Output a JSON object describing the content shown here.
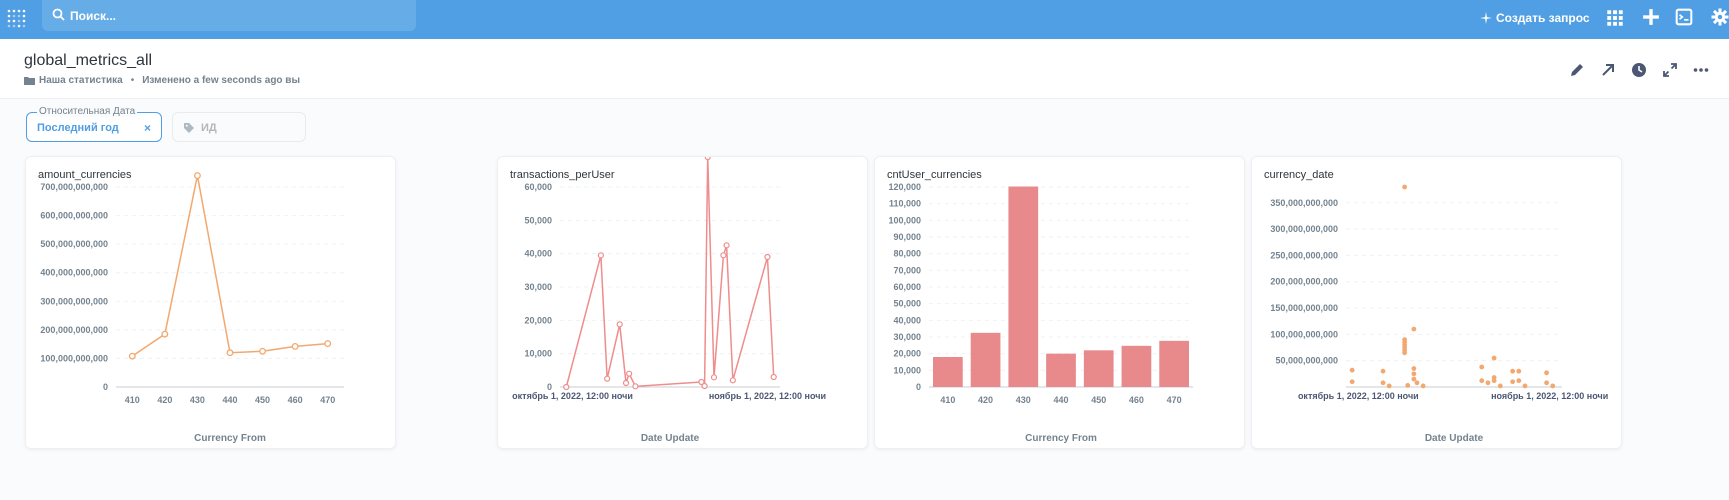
{
  "nav": {
    "search_placeholder": "Поиск...",
    "new_question": "Создать запрос",
    "colors": {
      "bar": "#509ee3",
      "search": "#66ace7"
    }
  },
  "header": {
    "title": "global_metrics_all",
    "collection": "Наша статистика",
    "edited": "Изменено a few seconds ago вы"
  },
  "filters": {
    "date_label": "Относительная Дата",
    "date_value": "Последний год",
    "clear": "×",
    "id_placeholder": "ИД"
  },
  "cards": [
    {
      "title": "amount_currencies",
      "chart_data": {
        "type": "line",
        "color": "#f2a86f",
        "categories": [
          "410",
          "420",
          "430",
          "440",
          "450",
          "460",
          "470"
        ],
        "values": [
          108000000000,
          185000000000,
          740000000000,
          120000000000,
          125000000000,
          142000000000,
          152000000000
        ],
        "xlabel": "Currency From",
        "ylim": [
          0,
          700000000000
        ],
        "yticks": [
          "0",
          "100,000,000,000",
          "200,000,000,000",
          "300,000,000,000",
          "400,000,000,000",
          "500,000,000,000",
          "600,000,000,000",
          "700,000,000,000"
        ]
      }
    },
    {
      "title": "transactions_perUser",
      "chart_data": {
        "type": "line",
        "color": "#ef8c8c",
        "x_ticks": [
          "октябрь 1, 2022, 12:00 ночи",
          "ноябрь 1, 2022, 12:00 ночи"
        ],
        "x": [
          -2,
          9,
          11,
          15,
          17,
          18,
          20,
          41,
          42,
          43,
          45,
          48,
          49,
          51,
          62,
          64
        ],
        "values": [
          0,
          39500,
          2500,
          18800,
          1200,
          4000,
          200,
          1500,
          300,
          69000,
          2900,
          39500,
          42500,
          2000,
          39000,
          3000
        ],
        "xlabel": "Date Update",
        "ylim": [
          0,
          60000
        ],
        "yticks": [
          "0",
          "10,000",
          "20,000",
          "30,000",
          "40,000",
          "50,000",
          "60,000"
        ]
      }
    },
    {
      "title": "cntUser_currencies",
      "chart_data": {
        "type": "bar",
        "color": "#e8898c",
        "categories": [
          "410",
          "420",
          "430",
          "440",
          "450",
          "460",
          "470"
        ],
        "values": [
          18000,
          32500,
          120300,
          20000,
          22000,
          24700,
          27700
        ],
        "xlabel": "Currency From",
        "ylim": [
          0,
          120000
        ],
        "yticks": [
          "0",
          "10,000",
          "20,000",
          "30,000",
          "40,000",
          "50,000",
          "60,000",
          "70,000",
          "80,000",
          "90,000",
          "100,000",
          "110,000",
          "120,000"
        ]
      }
    },
    {
      "title": "currency_date",
      "chart_data": {
        "type": "scatter",
        "color": "#f2a86f",
        "x_ticks": [
          "октябрь 1, 2022, 12:00 ночи",
          "ноябрь 1, 2022, 12:00 ночи"
        ],
        "points": [
          [
            -2,
            32000000000
          ],
          [
            -2,
            10000000000
          ],
          [
            8,
            30000000000
          ],
          [
            8,
            8000000000
          ],
          [
            10,
            2000000000
          ],
          [
            15,
            380000000000
          ],
          [
            15,
            90000000000
          ],
          [
            15,
            85000000000
          ],
          [
            15,
            80000000000
          ],
          [
            15,
            75000000000
          ],
          [
            15,
            70000000000
          ],
          [
            15,
            65000000000
          ],
          [
            16,
            3000000000
          ],
          [
            18,
            110000000000
          ],
          [
            18,
            35000000000
          ],
          [
            18,
            25000000000
          ],
          [
            18,
            15000000000
          ],
          [
            19,
            8000000000
          ],
          [
            21,
            2000000000
          ],
          [
            40,
            38000000000
          ],
          [
            40,
            12000000000
          ],
          [
            42,
            8000000000
          ],
          [
            44,
            55000000000
          ],
          [
            44,
            18000000000
          ],
          [
            44,
            12000000000
          ],
          [
            46,
            2000000000
          ],
          [
            50,
            30000000000
          ],
          [
            50,
            10000000000
          ],
          [
            52,
            30000000000
          ],
          [
            52,
            12000000000
          ],
          [
            54,
            2000000000
          ],
          [
            61,
            27000000000
          ],
          [
            61,
            8000000000
          ],
          [
            63,
            2000000000
          ]
        ],
        "xlabel": "Date Update",
        "ylim": [
          0,
          350000000000
        ],
        "yticks": [
          "50,000,000,000",
          "100,000,000,000",
          "150,000,000,000",
          "200,000,000,000",
          "250,000,000,000",
          "300,000,000,000",
          "350,000,000,000"
        ]
      }
    }
  ]
}
